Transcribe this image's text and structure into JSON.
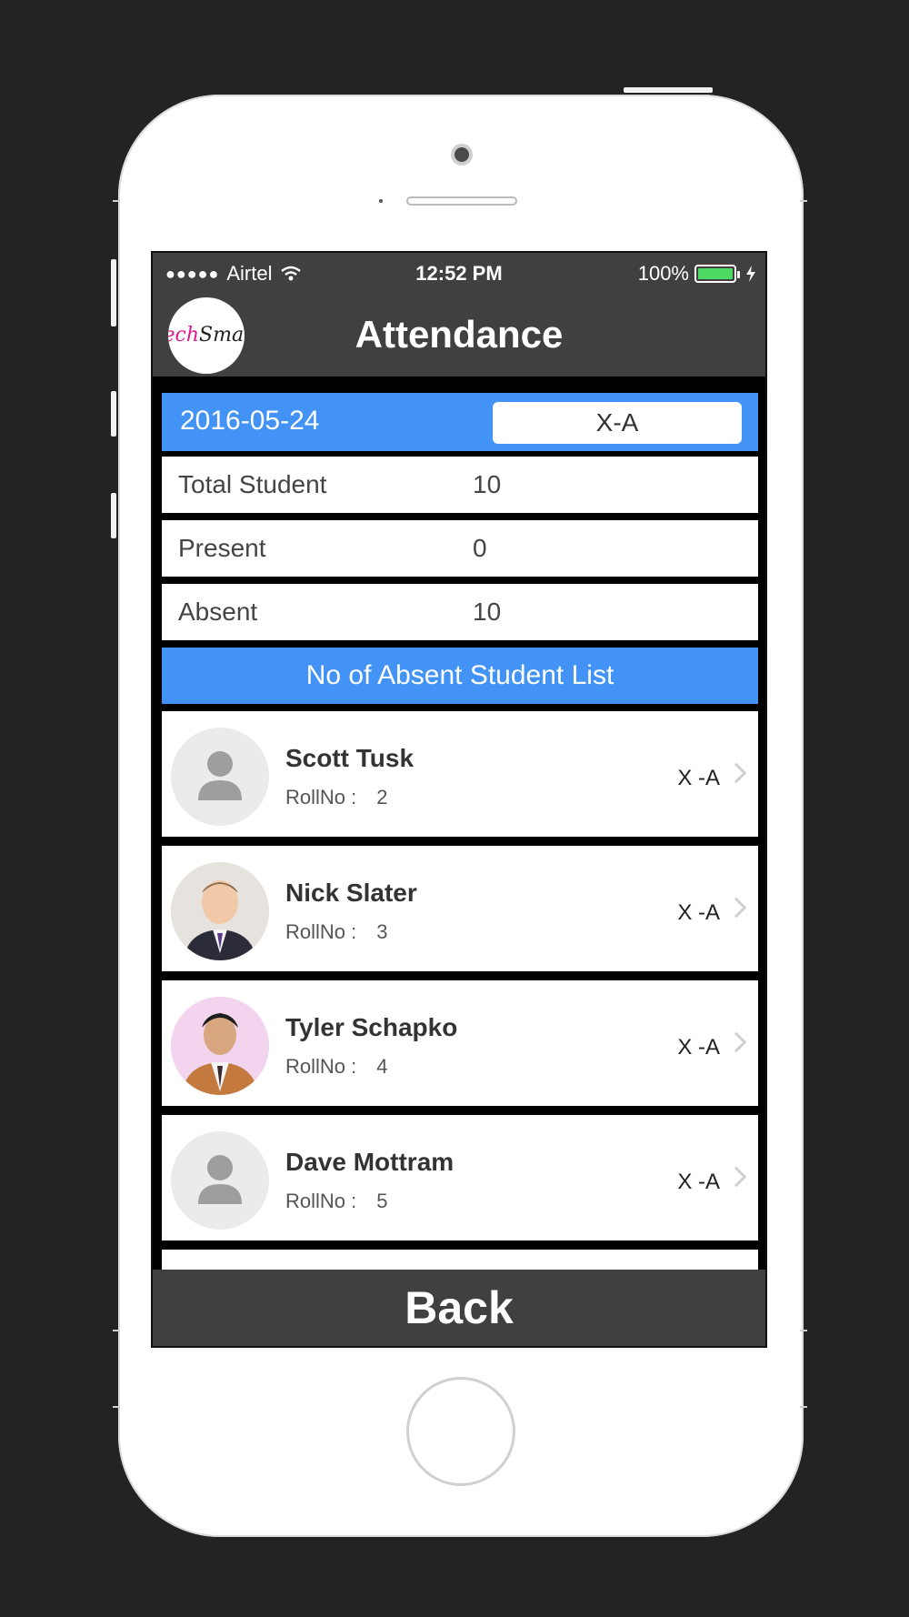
{
  "status_bar": {
    "carrier": "Airtel",
    "time": "12:52 PM",
    "battery": "100%"
  },
  "nav": {
    "title": "Attendance",
    "logo_text_1": "Tech",
    "logo_text_2": "Smart"
  },
  "filter": {
    "date": "2016-05-24",
    "class": "X-A"
  },
  "stats": {
    "total_label": "Total Student",
    "total_value": "10",
    "present_label": "Present",
    "present_value": "0",
    "absent_label": "Absent",
    "absent_value": "10"
  },
  "list_header": "No of Absent Student List",
  "students": [
    {
      "name": "Scott Tusk",
      "roll_label": "RollNo :",
      "roll": "2",
      "class": "X -A",
      "avatar": "placeholder"
    },
    {
      "name": "Nick Slater",
      "roll_label": "RollNo :",
      "roll": "3",
      "class": "X -A",
      "avatar": "photo"
    },
    {
      "name": "Tyler Schapko",
      "roll_label": "RollNo :",
      "roll": "4",
      "class": "X -A",
      "avatar": "photo"
    },
    {
      "name": "Dave Mottram",
      "roll_label": "RollNo :",
      "roll": "5",
      "class": "X -A",
      "avatar": "placeholder"
    }
  ],
  "footer": {
    "back_label": "Back"
  },
  "colors": {
    "accent": "#4293f5",
    "bar": "#404040",
    "battery": "#4cd964"
  }
}
